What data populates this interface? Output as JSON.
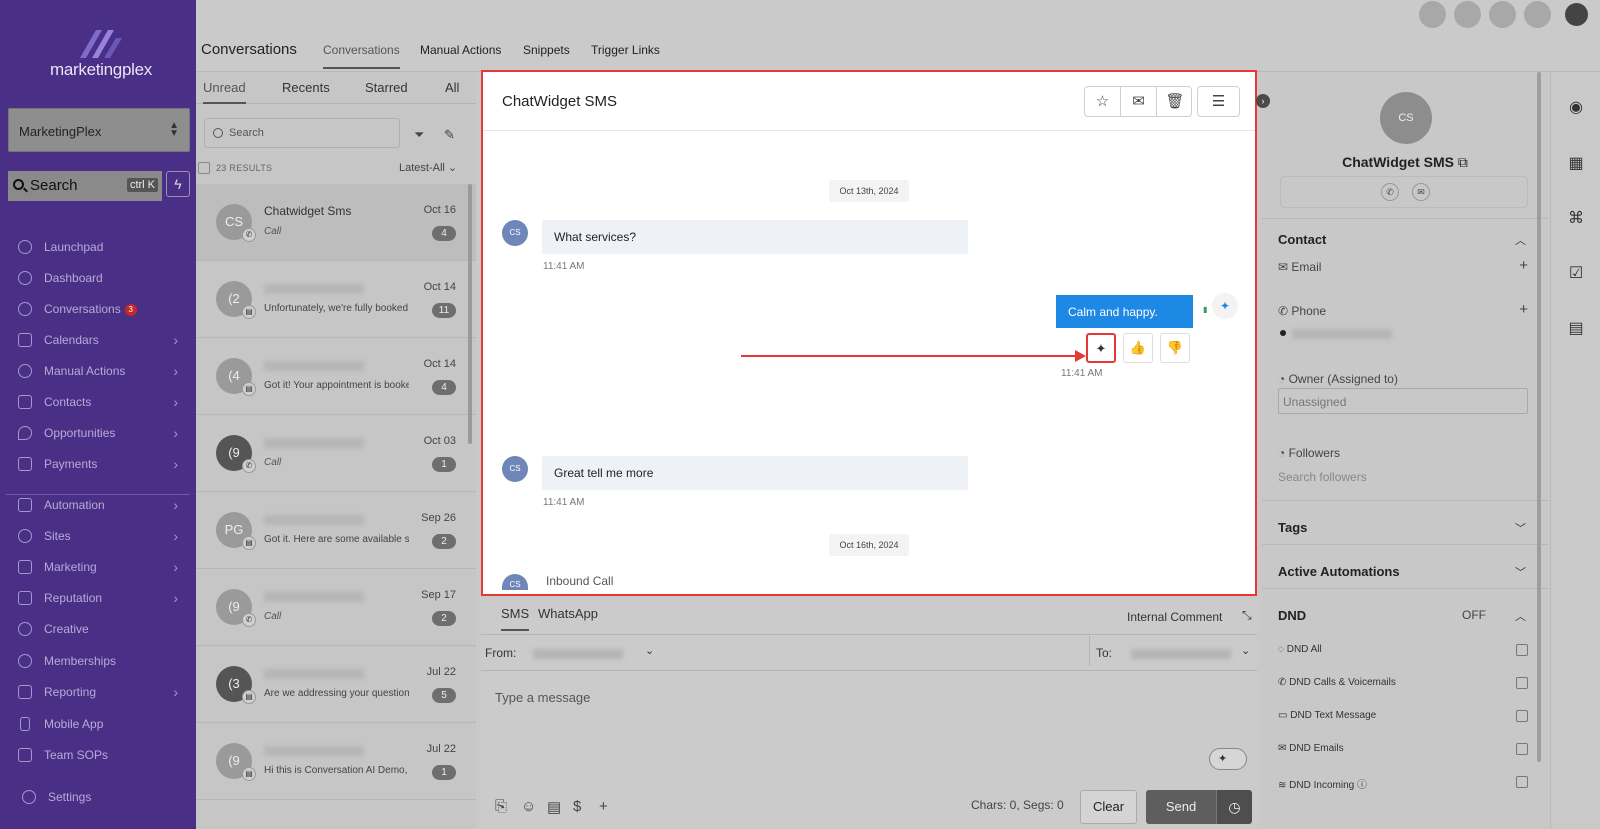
{
  "sidebar": {
    "logo_text": "marketingplex",
    "account": "MarketingPlex",
    "search_placeholder": "Search",
    "search_shortcut": "ctrl K",
    "items": [
      {
        "label": "Launchpad",
        "icon": "rocket-icon",
        "arrow": false
      },
      {
        "label": "Dashboard",
        "icon": "gauge-icon",
        "arrow": false
      },
      {
        "label": "Conversations",
        "icon": "chat-icon",
        "arrow": false,
        "badge": "3"
      },
      {
        "label": "Calendars",
        "icon": "calendar-icon",
        "arrow": true
      },
      {
        "label": "Manual Actions",
        "icon": "check-circle-icon",
        "arrow": true
      },
      {
        "label": "Contacts",
        "icon": "contacts-icon",
        "arrow": true
      },
      {
        "label": "Opportunities",
        "icon": "flame-icon",
        "arrow": true
      },
      {
        "label": "Payments",
        "icon": "card-icon",
        "arrow": true
      },
      {
        "label": "Automation",
        "icon": "automation-icon",
        "arrow": true
      },
      {
        "label": "Sites",
        "icon": "globe-icon",
        "arrow": true
      },
      {
        "label": "Marketing",
        "icon": "send-icon",
        "arrow": true
      },
      {
        "label": "Reputation",
        "icon": "star-icon",
        "arrow": true
      },
      {
        "label": "Creative",
        "icon": "palette-icon",
        "arrow": false
      },
      {
        "label": "Memberships",
        "icon": "badge-icon",
        "arrow": false
      },
      {
        "label": "Reporting",
        "icon": "chart-icon",
        "arrow": true
      },
      {
        "label": "Mobile App",
        "icon": "phone-icon",
        "arrow": false
      },
      {
        "label": "Team SOPs",
        "icon": "list-icon",
        "arrow": false
      },
      {
        "label": "Settings",
        "icon": "gear-icon",
        "arrow": false
      }
    ]
  },
  "topbar": {
    "title": "Conversations",
    "tabs": [
      "Conversations",
      "Manual Actions",
      "Snippets",
      "Trigger Links"
    ]
  },
  "convlist": {
    "tabs": [
      "Unread",
      "Recents",
      "Starred",
      "All"
    ],
    "search_placeholder": "Search",
    "results": "23 RESULTS",
    "sort": "Latest-All",
    "items": [
      {
        "initials": "CS",
        "name": "Chatwidget Sms",
        "preview": "Call",
        "date": "Oct 16",
        "count": "4",
        "type": "call"
      },
      {
        "initials": "(2",
        "name": "",
        "preview": "Unfortunately, we're fully booked",
        "date": "Oct 14",
        "count": "11",
        "type": "sms"
      },
      {
        "initials": "(4",
        "name": "",
        "preview": "Got it! Your appointment is booke",
        "date": "Oct 14",
        "count": "4",
        "type": "sms"
      },
      {
        "initials": "(9",
        "name": "",
        "preview": "Call",
        "date": "Oct 03",
        "count": "1",
        "type": "call"
      },
      {
        "initials": "PG",
        "name": "",
        "preview": "Got it. Here are some available sl",
        "date": "Sep 26",
        "count": "2",
        "type": "sms"
      },
      {
        "initials": "(9",
        "name": "",
        "preview": "Call",
        "date": "Sep 17",
        "count": "2",
        "type": "call"
      },
      {
        "initials": "(3",
        "name": "",
        "preview": "Are we addressing your question:",
        "date": "Jul 22",
        "count": "5",
        "type": "sms"
      },
      {
        "initials": "(9",
        "name": "",
        "preview": "Hi this is Conversation AI Demo, I",
        "date": "Jul 22",
        "count": "1",
        "type": "sms"
      }
    ]
  },
  "chat": {
    "title": "ChatWidget SMS",
    "date1": "Oct 13th, 2024",
    "date2": "Oct 16th, 2024",
    "avatar": "CS",
    "msg1": "What services?",
    "time1": "11:41 AM",
    "reply": "Calm and happy.",
    "time2": "11:41 AM",
    "msg2": "Great tell me more",
    "time3": "11:41 AM",
    "inbound": "Inbound Call"
  },
  "composer": {
    "tabs": [
      "SMS",
      "WhatsApp"
    ],
    "internal": "Internal Comment",
    "from_label": "From:",
    "to_label": "To:",
    "placeholder": "Type a message",
    "chars": "Chars: 0, Segs: 0",
    "clear": "Clear",
    "send": "Send"
  },
  "rpanel": {
    "initials": "CS",
    "name": "ChatWidget SMS",
    "contact_head": "Contact",
    "email": "Email",
    "phone": "Phone",
    "owner": "Owner (Assigned to)",
    "owner_value": "Unassigned",
    "followers": "Followers",
    "followers_placeholder": "Search followers",
    "tags": "Tags",
    "automations": "Active Automations",
    "dnd": "DND",
    "dnd_state": "OFF",
    "dnd_items": [
      "DND All",
      "DND Calls & Voicemails",
      "DND Text Message",
      "DND Emails",
      "DND Incoming"
    ]
  },
  "colors": {
    "sidebar": "#4a2f86",
    "highlight": "#e53935",
    "reply_bubble": "#1e88e5"
  }
}
